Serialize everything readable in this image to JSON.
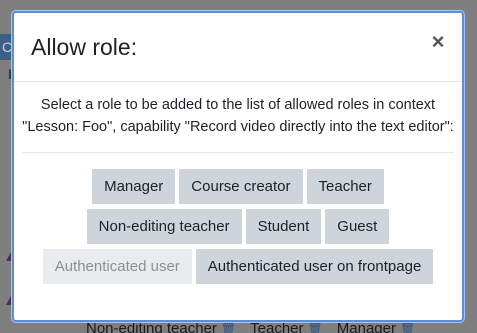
{
  "background": {
    "chip_text": "C",
    "letter": "R",
    "footer_items": [
      "Non-editing teacher",
      "Teacher",
      "Manager"
    ]
  },
  "modal": {
    "title": "Allow role:",
    "close_symbol": "×",
    "description": "Select a role to be added to the list of allowed roles in context \"Lesson: Foo\", capability \"Record video directly into the text editor\":",
    "roles": [
      {
        "label": "Manager",
        "enabled": true
      },
      {
        "label": "Course creator",
        "enabled": true
      },
      {
        "label": "Teacher",
        "enabled": true
      },
      {
        "label": "Non-editing teacher",
        "enabled": true
      },
      {
        "label": "Student",
        "enabled": true
      },
      {
        "label": "Guest",
        "enabled": true
      },
      {
        "label": "Authenticated user",
        "enabled": false
      },
      {
        "label": "Authenticated user on frontpage",
        "enabled": true
      }
    ]
  },
  "colors": {
    "modal_border": "#5b8ed6",
    "button_bg": "#ced4da",
    "button_disabled_bg": "#e9ecef",
    "trash_icon": "#2b4f80"
  },
  "icons": {
    "close": "close-icon",
    "delete": "trash-icon"
  }
}
